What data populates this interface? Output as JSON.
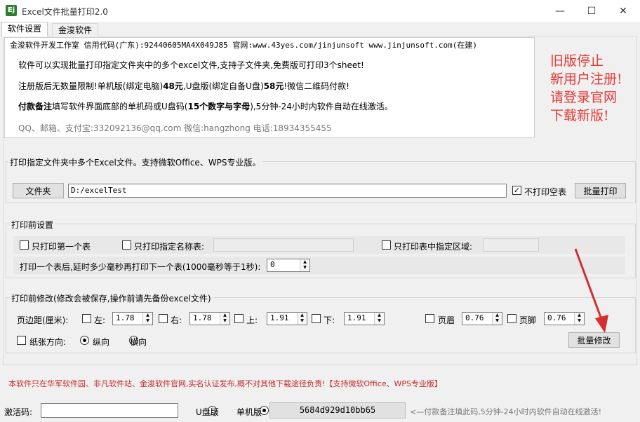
{
  "window": {
    "title": "Excel文件批量打印2.0",
    "icon_letter": "Ej"
  },
  "tabs": [
    {
      "label": "软件设置"
    },
    {
      "label": "金浚软件"
    }
  ],
  "info": {
    "header": "金浚软件开发工作室 信用代码(广东):92440605MA4X049J85 官网:www.43yes.com/jinjunsoft  www.jinjunsoft.com(在建)",
    "line1": "软件可以实现批量打印指定文件夹中的多个excel文件,支持子文件夹,免费版可打印3个sheet!",
    "line2_a": "注册版后无数量限制!单机版(绑定电脑)",
    "line2_b": "48元",
    "line2_c": ",U盘版(绑定自备U盘)",
    "line2_d": "58元",
    "line2_e": "!微信二维码付款!",
    "line3_a": "付款备注",
    "line3_b": "填写软件界面底部的单机码或U盘码(",
    "line3_c": "15个数字与字母",
    "line3_d": "),5分钟-24小时内软件自动在线激活。",
    "contact": "QQ、邮箱、支付宝:332092136@qq.com   微信:hangzhong   电话:18934355455"
  },
  "notice": [
    "旧版停止",
    "新用户注册!",
    "请登录官网",
    "下载新版!"
  ],
  "print_group": {
    "title": "打印指定文件夹中多个Excel文件。支持微软Office、WPS专业版。",
    "folder_button": "文件夹",
    "folder_path": "D:/excelTest",
    "skip_blank_label": "不打印空表",
    "skip_blank_checked": true,
    "batch_print_button": "批量打印"
  },
  "pre_print": {
    "title": "打印前设置",
    "first_sheet_label": "只打印第一个表",
    "named_sheet_label": "只打印指定名称表:",
    "named_sheet_value": "",
    "region_label": "只打印表中指定区域:",
    "region_value": "",
    "delay_label": "打印一个表后,延时多少毫秒再打印下一个表(1000毫秒等于1秒):",
    "delay_value": "0"
  },
  "pre_modify": {
    "title": "打印前修改(修改会被保存,操作前请先备份excel文件)",
    "margin_label": "页边距(厘米):",
    "left_label": "左:",
    "left_value": "1.78",
    "right_label": "右:",
    "right_value": "1.78",
    "top_label": "上:",
    "top_value": "1.91",
    "bottom_label": "下:",
    "bottom_value": "1.91",
    "header_label": "页眉",
    "header_value": "0.76",
    "footer_label": "页脚",
    "footer_value": "0.76",
    "orientation_label": "纸张方向:",
    "portrait_label": "纵向",
    "landscape_label": "横向",
    "orientation_selected": "portrait",
    "batch_modify_button": "批量修改"
  },
  "disclaimer": "本软件只在华军软件园、非凡软件站、金浚软件官网,实名认证发布,概不对其他下载途径负责!【支持微软Office、WPS专业版】",
  "footer": {
    "activation_label": "激活码:",
    "activation_value": "",
    "usb_label": "U盘版",
    "standalone_label": "单机版",
    "selected_edition": "standalone",
    "machine_code": "5684d929d10bb65",
    "hint": "<—付款备注填此码,5分钟-24小时内软件自动在线激活!"
  },
  "colors": {
    "accent_red": "#e53935",
    "dark_red": "#c62828",
    "contact_gray": "#777777"
  }
}
